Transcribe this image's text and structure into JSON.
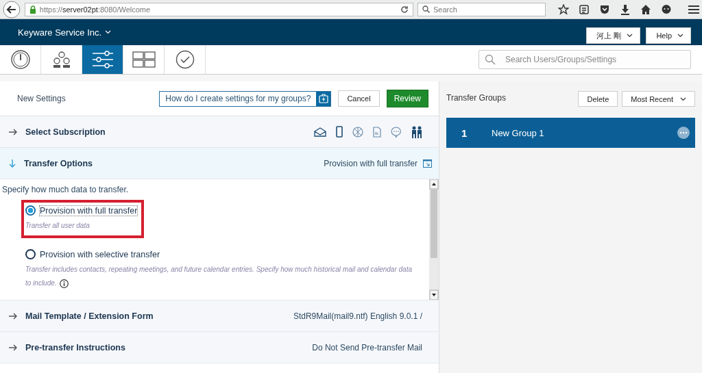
{
  "browser": {
    "url": "https://**server02pt**:8080/Welcome",
    "search_placeholder": "Search"
  },
  "header": {
    "company": "Keyware Service Inc.",
    "user": "河上 剛",
    "help": "Help"
  },
  "nav_tabs": [
    {
      "kind": "gauge",
      "selected": false
    },
    {
      "kind": "users",
      "selected": false
    },
    {
      "kind": "sliders",
      "selected": true
    },
    {
      "kind": "grid",
      "selected": false
    },
    {
      "kind": "check",
      "selected": false
    }
  ],
  "search": {
    "placeholder": "Search Users/Groups/Settings"
  },
  "settings": {
    "title": "New Settings",
    "help_question": "How do I create settings for my groups?",
    "cancel": "Cancel",
    "review": "Review"
  },
  "sections": [
    {
      "title": "Select Subscription",
      "expanded": false,
      "icons": [
        {
          "kind": "mail"
        },
        {
          "kind": "phone"
        },
        {
          "kind": "globe"
        },
        {
          "kind": "document"
        },
        {
          "kind": "chat"
        },
        {
          "kind": "people"
        }
      ]
    },
    {
      "title": "Transfer Options",
      "expanded": true,
      "summary": "Provision with full transfer"
    },
    {
      "title": "Mail Template / Extension Form",
      "expanded": false,
      "summary": "StdR9Mail(mail9.ntf) English 9.0.1 /"
    },
    {
      "title": "Pre-transfer Instructions",
      "expanded": false,
      "summary": "Do Not Send Pre-transfer Mail"
    }
  ],
  "transfer": {
    "instruction": "Specify how much data to transfer.",
    "options": [
      {
        "label": "Provision with full transfer",
        "description": "Transfer all user data",
        "selected": true,
        "highlighted": true,
        "info": false
      },
      {
        "label": "Provision with selective transfer",
        "description": "Transfer includes contacts, repeating meetings, and future calendar entries. Specify how much historical mail and calendar data to include.",
        "selected": false,
        "highlighted": false,
        "info": true
      }
    ]
  },
  "groups_panel": {
    "title": "Transfer Groups",
    "delete": "Delete",
    "sort": "Most Recent",
    "groups": [
      {
        "number": "1",
        "name": "New Group 1",
        "selected": true
      }
    ]
  }
}
